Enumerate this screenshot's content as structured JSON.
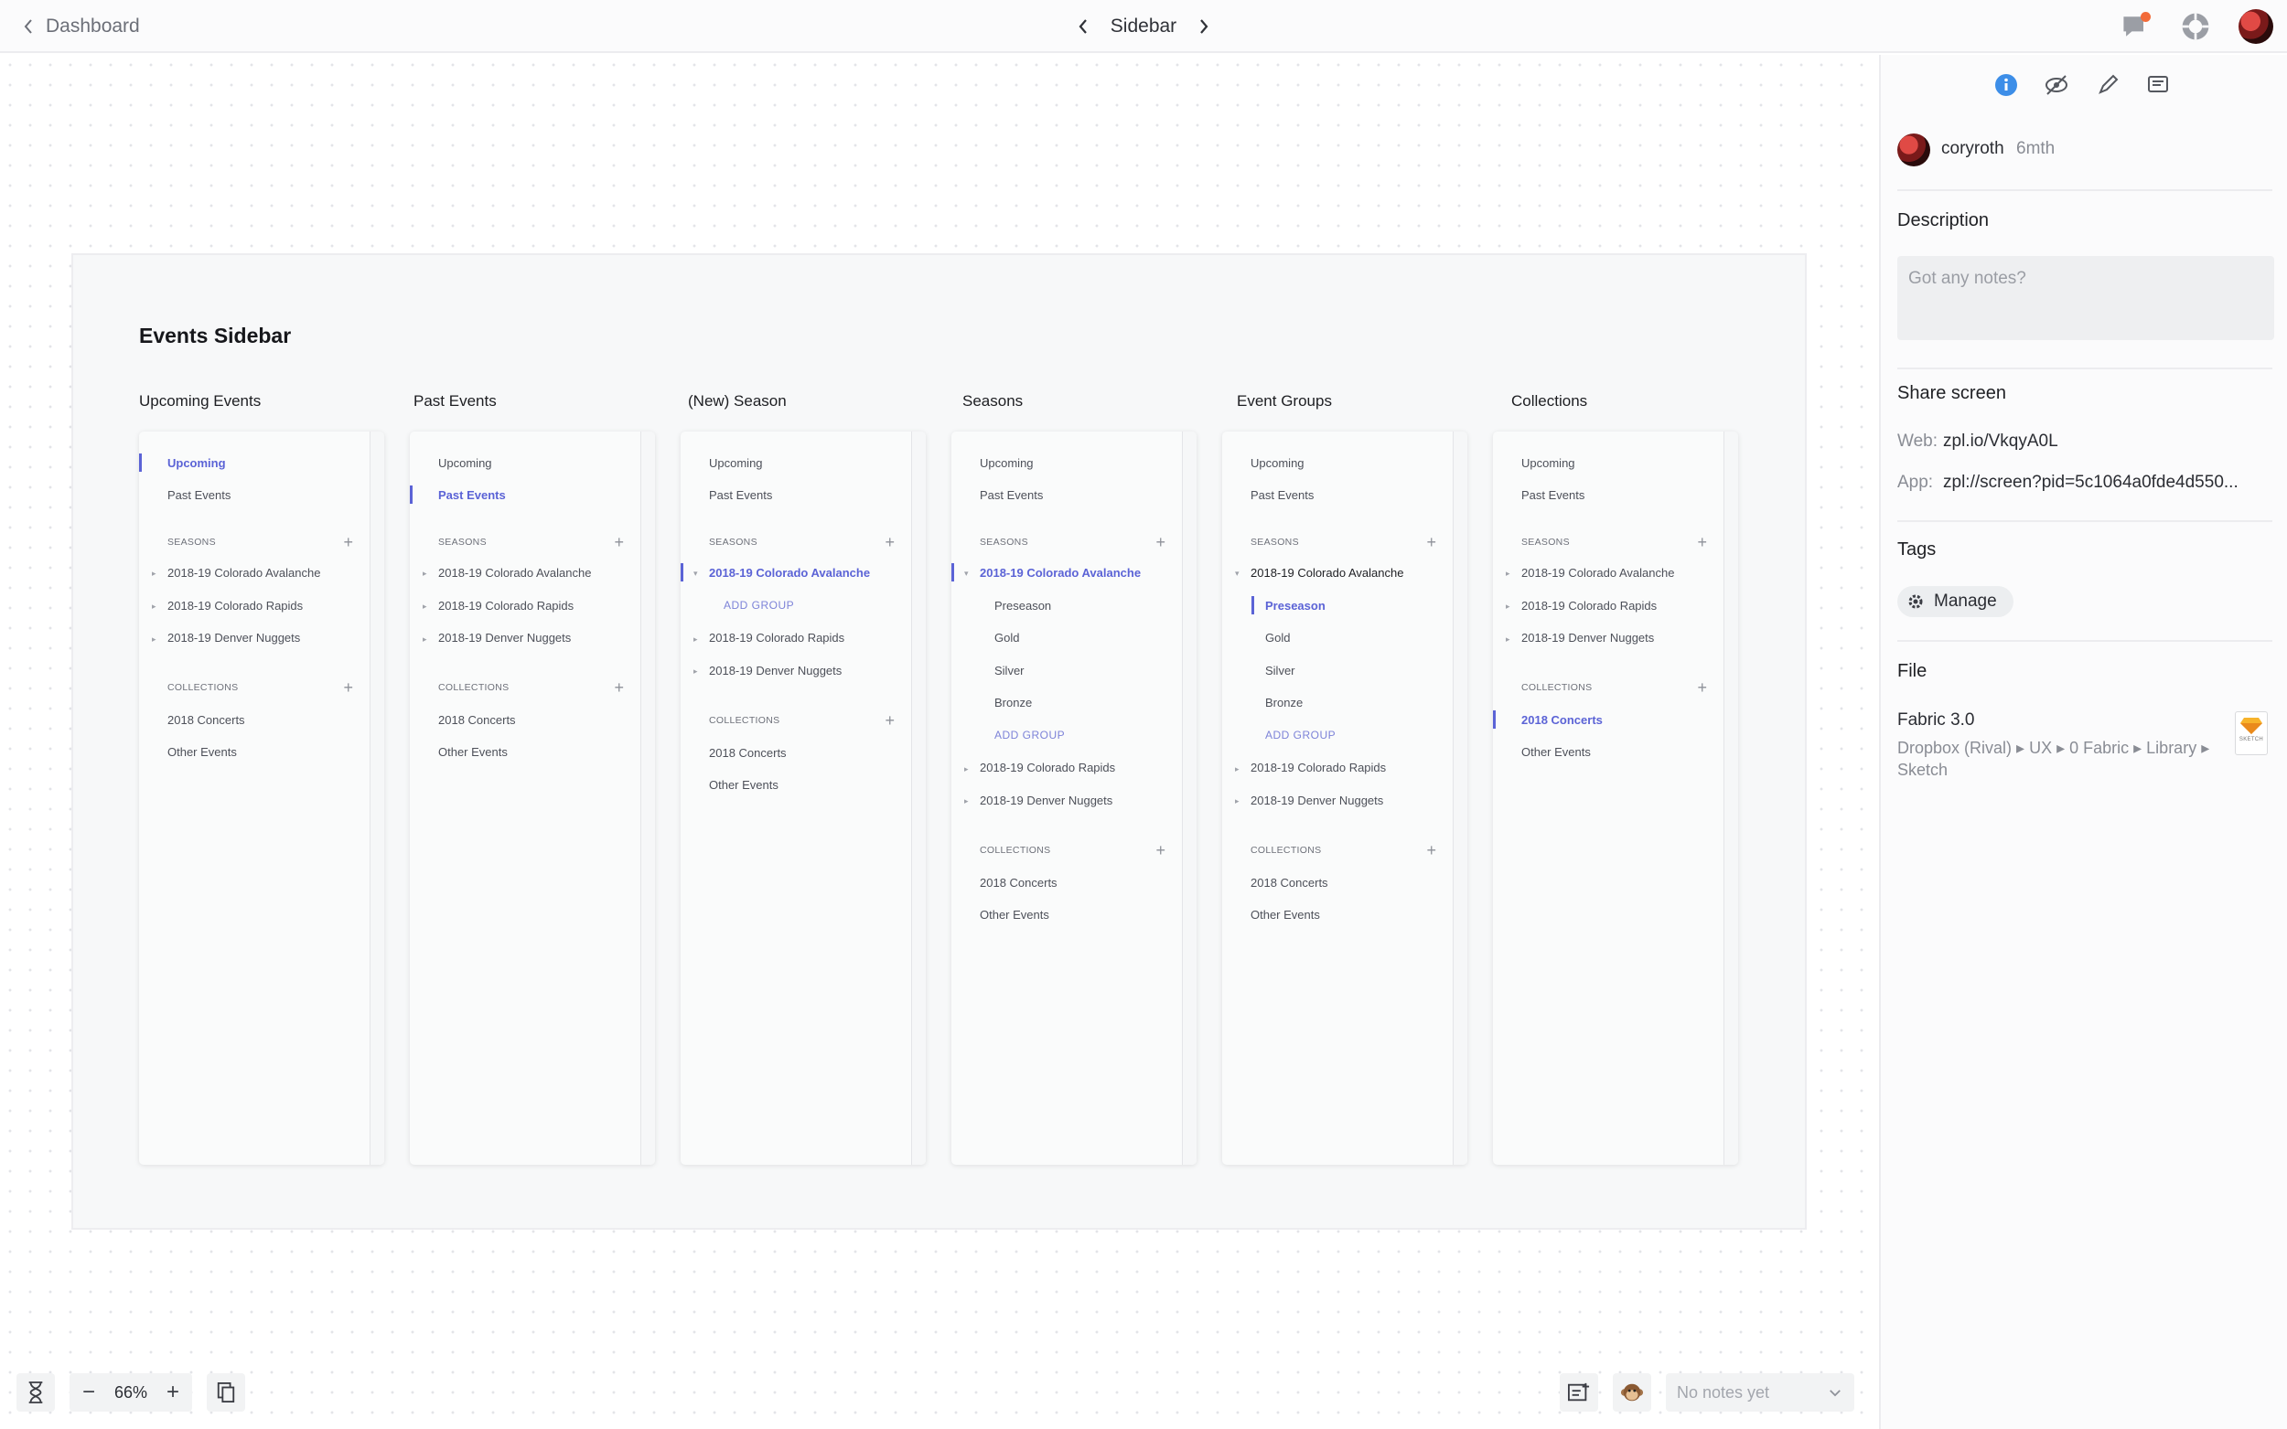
{
  "topbar": {
    "back_label": "Dashboard",
    "screen_title": "Sidebar"
  },
  "artboard": {
    "title": "Events Sidebar",
    "columns": [
      {
        "title": "Upcoming Events"
      },
      {
        "title": "Past Events"
      },
      {
        "title": "(New) Season"
      },
      {
        "title": "Seasons"
      },
      {
        "title": "Event Groups"
      },
      {
        "title": "Collections"
      }
    ]
  },
  "nav": {
    "upcoming": "Upcoming",
    "past_events": "Past Events",
    "seasons_header": "SEASONS",
    "collections_header": "COLLECTIONS",
    "avalanche": "2018-19 Colorado Avalanche",
    "rapids": "2018-19 Colorado Rapids",
    "nuggets": "2018-19 Denver Nuggets",
    "add_group": "ADD GROUP",
    "preseason": "Preseason",
    "gold": "Gold",
    "silver": "Silver",
    "bronze": "Bronze",
    "concerts": "2018 Concerts",
    "other_events": "Other Events",
    "plus": "+"
  },
  "sidebar": {
    "author": "coryroth",
    "age": "6mth",
    "description_label": "Description",
    "notes_placeholder": "Got any notes?",
    "share_label": "Share screen",
    "web_label": "Web:",
    "web_value": "zpl.io/VkqyA0L",
    "app_label": "App:",
    "app_value": "zpl://screen?pid=5c1064a0fde4d550...",
    "tags_label": "Tags",
    "manage_label": "Manage",
    "file_label": "File",
    "file_name": "Fabric 3.0",
    "file_path_line1": "Dropbox (Rival) ▸ UX ▸ 0 Fabric ▸ Library ▸",
    "file_path_line2": "Sketch",
    "sketch_badge": "SKETCH"
  },
  "bottombar": {
    "zoom_minus": "−",
    "zoom_value": "66%",
    "zoom_plus": "+",
    "notes_status": "No notes yet"
  },
  "colors": {
    "accent": "#5b63d6",
    "info_blue": "#3d8ee8",
    "notification": "#f26b3a"
  },
  "icons": [
    "back-chevron-icon",
    "prev-screen-icon",
    "next-screen-icon",
    "notification-icon",
    "help-icon",
    "info-icon",
    "eye-icon",
    "pen-icon",
    "comment-icon",
    "gear-icon",
    "hourglass-icon",
    "copy-icon",
    "add-note-icon",
    "monkey-icon",
    "chevron-down-icon",
    "sketch-file-icon"
  ]
}
